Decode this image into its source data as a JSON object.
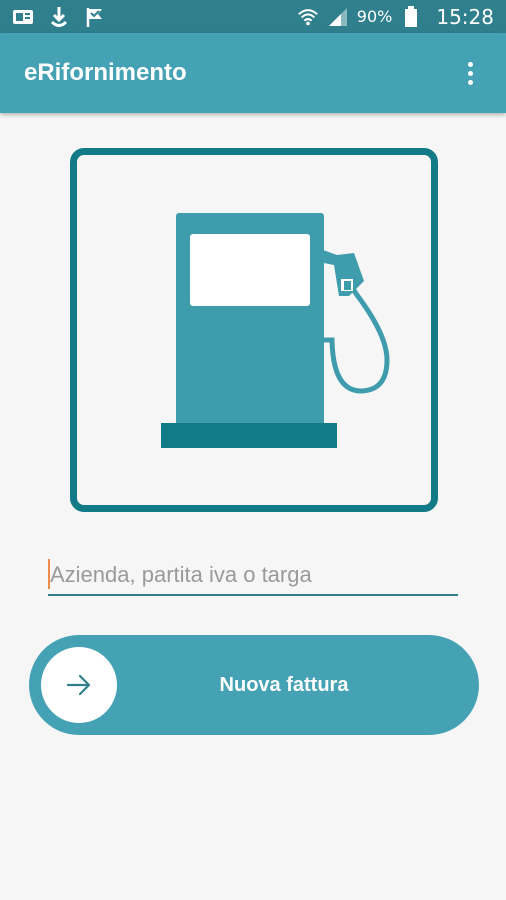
{
  "status_bar": {
    "left_icons": [
      "sim-card-icon",
      "download-icon",
      "flag-check-icon"
    ],
    "battery_percent": "90%",
    "time": "15:28"
  },
  "app_bar": {
    "title": "eRifornimento",
    "menu_icon": "more-vert-icon"
  },
  "hero": {
    "icon": "fuel-pump-icon"
  },
  "search": {
    "placeholder": "Azienda, partita iva o targa",
    "value": ""
  },
  "primary_action": {
    "label": "Nuova fattura",
    "icon": "arrow-right-icon"
  },
  "colors": {
    "status_bar": "#2f7f8c",
    "app_bar": "#45a2b4",
    "accent": "#137a88",
    "caret": "#f08a4b"
  }
}
